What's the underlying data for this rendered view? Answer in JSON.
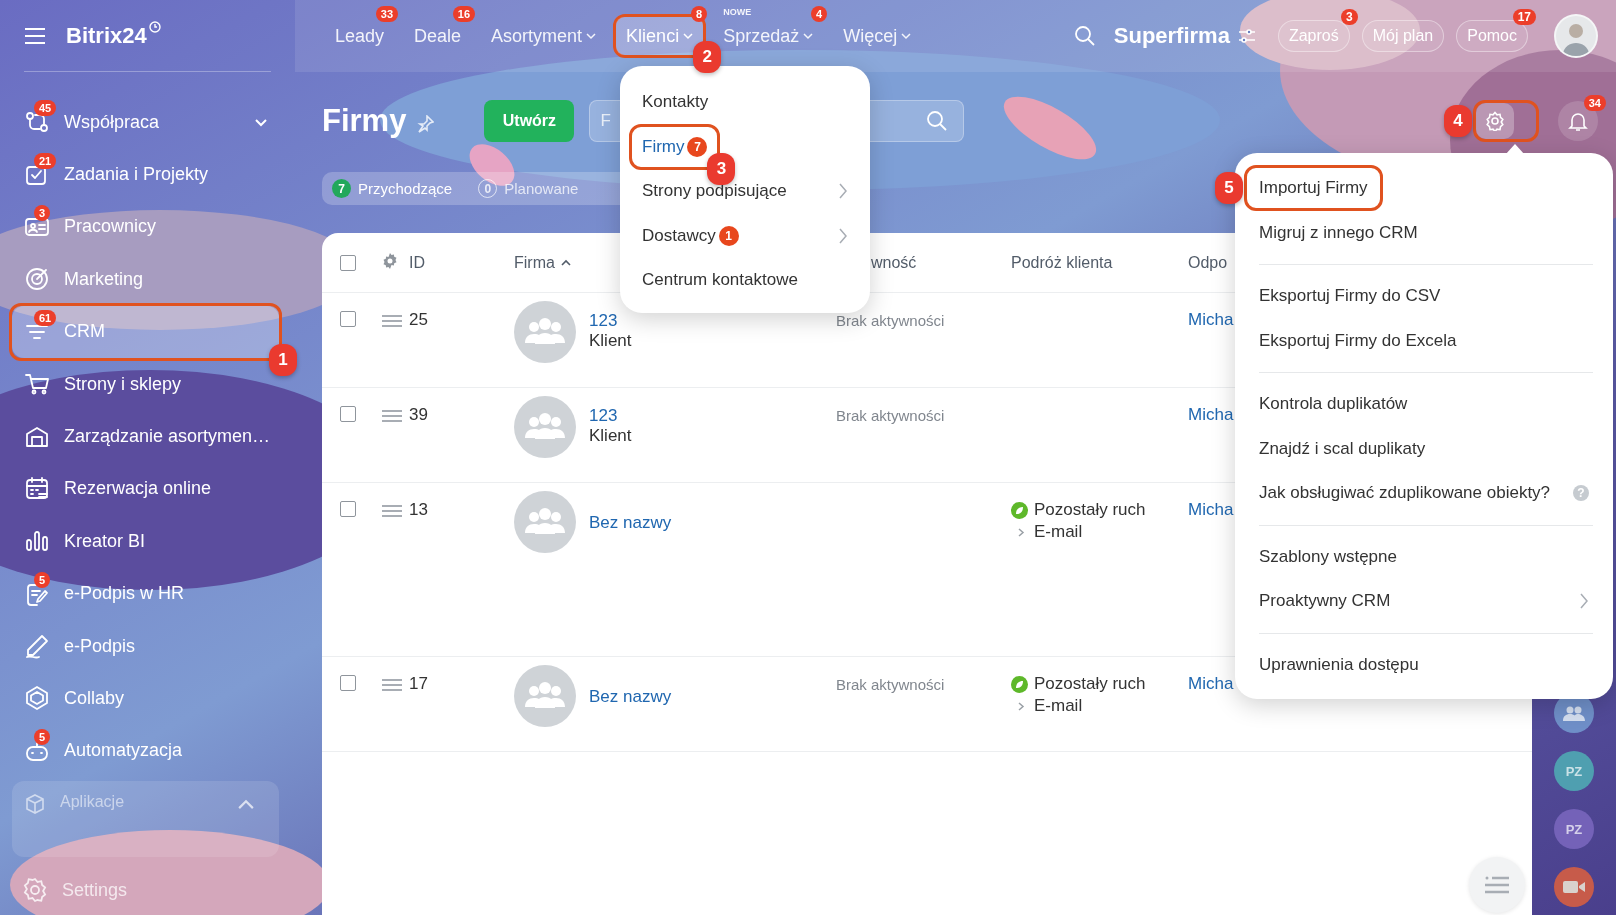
{
  "sidebar": {
    "logo": "Bitrix24",
    "items": [
      {
        "label": "Współpraca",
        "badge": "45",
        "selected": false,
        "expandable": true
      },
      {
        "label": "Zadania i Projekty",
        "badge": "21",
        "selected": false
      },
      {
        "label": "Pracownicy",
        "badge": "3",
        "selected": false
      },
      {
        "label": "Marketing",
        "selected": false
      },
      {
        "label": "CRM",
        "badge": "61",
        "selected": true,
        "step": "1"
      },
      {
        "label": "Strony i sklepy",
        "selected": false
      },
      {
        "label": "Zarządzanie asortymen…",
        "selected": false
      },
      {
        "label": "Rezerwacja online",
        "selected": false
      },
      {
        "label": "Kreator BI",
        "selected": false
      },
      {
        "label": "e-Podpis w HR",
        "badge": "5",
        "selected": false
      },
      {
        "label": "e-Podpis",
        "selected": false
      },
      {
        "label": "Collaby",
        "selected": false
      },
      {
        "label": "Automatyzacja",
        "badge": "5",
        "selected": false
      }
    ],
    "apps": {
      "label": "Aplikacje",
      "expanded": true
    },
    "settings": "Settings"
  },
  "topbar": {
    "nav": [
      {
        "label": "Leady",
        "badge": "33",
        "selected": false,
        "menu": false
      },
      {
        "label": "Deale",
        "badge": "16",
        "selected": false,
        "menu": false
      },
      {
        "label": "Asortyment",
        "selected": false,
        "menu": true
      },
      {
        "label": "Klienci",
        "badge": "8",
        "selected": true,
        "menu": true,
        "step": "2"
      },
      {
        "label": "Sprzedaż",
        "badge": "4",
        "tag": "NOWE",
        "selected": false,
        "menu": true
      },
      {
        "label": "Więcej",
        "selected": false,
        "menu": true
      }
    ],
    "company": "Superfirma",
    "buttons": [
      {
        "label": "Zaproś",
        "badge": "3"
      },
      {
        "label": "Mój plan"
      },
      {
        "label": "Pomoc",
        "badge": "17"
      }
    ]
  },
  "page": {
    "title": "Firmy",
    "create_button": "Utwórz",
    "search": {
      "placeholder": "F"
    },
    "counters": [
      {
        "count": "7",
        "label": "Przychodzące",
        "active": true
      },
      {
        "count": "0",
        "label": "Planowane",
        "active": false
      }
    ],
    "settings_step": "4",
    "notifications_badge": "34"
  },
  "table": {
    "header_checked": false,
    "columns": [
      {
        "label": "ID"
      },
      {
        "label": "Firma",
        "sort_ascending": true
      },
      {
        "label": "wność"
      },
      {
        "label": "Podróż klienta"
      },
      {
        "label": "Odpo"
      }
    ],
    "rows": [
      {
        "id": "25",
        "name": "123",
        "subtitle": "Klient",
        "activity": "Brak aktywności",
        "responsible": "Micha",
        "checked": false
      },
      {
        "id": "39",
        "name": "123",
        "subtitle": "Klient",
        "activity": "Brak aktywności",
        "responsible": "Micha",
        "checked": false
      },
      {
        "id": "13",
        "name": "Bez nazwy",
        "journey": {
          "stage": "Pozostały ruch",
          "channel": "E-mail"
        },
        "responsible": "Micha",
        "checked": false
      },
      {
        "id": "17",
        "name": "Bez nazwy",
        "activity": "Brak aktywności",
        "journey": {
          "stage": "Pozostały ruch",
          "channel": "E-mail"
        },
        "responsible": "Micha",
        "checked": false
      }
    ]
  },
  "clients_menu": {
    "items": [
      {
        "label": "Kontakty",
        "selected": false
      },
      {
        "label": "Firmy",
        "badge": "7",
        "selected": true,
        "step": "3"
      },
      {
        "label": "Strony podpisujące",
        "selected": false,
        "submenu": true
      },
      {
        "label": "Dostawcy",
        "badge": "1",
        "selected": false,
        "submenu": true
      },
      {
        "label": "Centrum kontaktowe",
        "selected": false
      }
    ]
  },
  "settings_menu": {
    "groups": [
      {
        "items": [
          {
            "label": "Importuj Firmy",
            "step": "5"
          },
          {
            "label": "Migruj z innego CRM"
          }
        ]
      },
      {
        "items": [
          {
            "label": "Eksportuj Firmy do CSV"
          },
          {
            "label": "Eksportuj Firmy do Excela"
          }
        ]
      },
      {
        "items": [
          {
            "label": "Kontrola duplikatów"
          },
          {
            "label": "Znajdź i scal duplikaty"
          },
          {
            "label": "Jak obsługiwać zduplikowane obiekty?",
            "help": "?"
          }
        ]
      },
      {
        "items": [
          {
            "label": "Szablony wstępne"
          },
          {
            "label": "Proaktywny CRM",
            "submenu": true
          }
        ]
      },
      {
        "items": [
          {
            "label": "Uprawnienia dostępu"
          }
        ]
      }
    ]
  },
  "rail": [
    {
      "kind": "group"
    },
    {
      "kind": "initials",
      "text": "PZ",
      "color": "#4f9fb0"
    },
    {
      "kind": "initials",
      "text": "PZ",
      "color": "#7462b8"
    },
    {
      "kind": "video"
    }
  ]
}
